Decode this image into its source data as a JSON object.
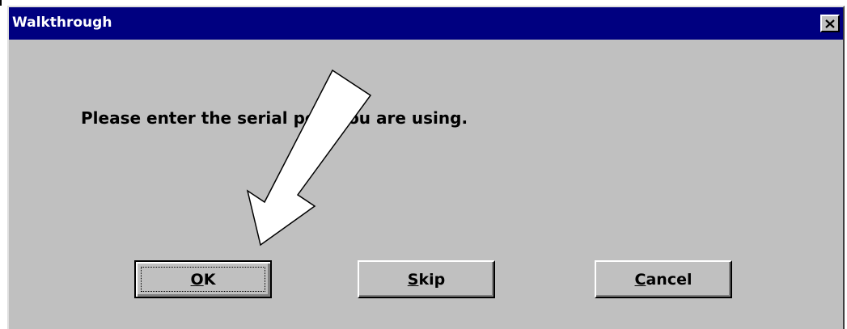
{
  "window": {
    "title": "Walkthrough",
    "close_icon": "close-icon",
    "title_bar_color": "#000080",
    "body_color": "#c0c0c0"
  },
  "message": {
    "text": "Please enter the serial port you are using."
  },
  "buttons": {
    "ok": {
      "mnemonic": "O",
      "rest": "K"
    },
    "skip": {
      "mnemonic": "S",
      "rest": "kip"
    },
    "cancel": {
      "mnemonic": "C",
      "rest": "ancel"
    }
  },
  "overlay": {
    "arrow_icon": "pointer-arrow-icon",
    "arrow_fill": "#ffffff",
    "arrow_stroke": "#000000"
  }
}
